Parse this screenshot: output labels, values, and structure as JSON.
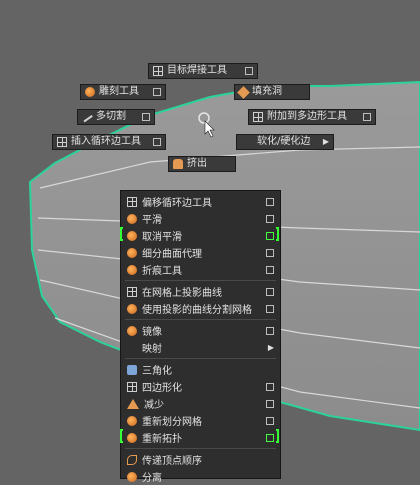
{
  "colors": {
    "mesh_outline": "#2bd39a",
    "highlight": "#42ff42",
    "menu_bg": "#2e2e2e"
  },
  "marking_menu": {
    "top": {
      "label": "目标焊接工具",
      "icon": "grid-icon"
    },
    "left_top": {
      "label": "雕刻工具",
      "icon": "sculpt-icon"
    },
    "right_top": {
      "label": "填充洞",
      "icon": "fill-hole-icon"
    },
    "left": {
      "label": "多切割",
      "icon": "knife-icon"
    },
    "right": {
      "label": "附加到多边形工具",
      "icon": "append-polygon-icon"
    },
    "left_bottom": {
      "label": "插入循环边工具",
      "icon": "insert-loop-icon"
    },
    "right_bottom": {
      "label": "软化/硬化边",
      "icon": "submenu-arrow"
    },
    "bottom": {
      "label": "挤出",
      "icon": "extrude-icon"
    }
  },
  "context_menu": {
    "items": [
      {
        "label": "偏移循环边工具",
        "icon": "offset-loop-icon"
      },
      {
        "label": "平滑",
        "icon": "smooth-icon"
      },
      {
        "label": "取消平滑",
        "icon": "unsmooth-icon"
      },
      {
        "label": "细分曲面代理",
        "icon": "subdiv-proxy-icon"
      },
      {
        "label": "折痕工具",
        "icon": "crease-icon"
      },
      {
        "label": "在网格上投影曲线",
        "icon": "project-curve-icon"
      },
      {
        "label": "使用投影的曲线分割网格",
        "icon": "split-mesh-icon"
      },
      {
        "label": "镜像",
        "icon": "mirror-icon"
      },
      {
        "label": "映射",
        "icon": "submenu-arrow"
      },
      {
        "label": "三角化",
        "icon": "triangulate-icon"
      },
      {
        "label": "四边形化",
        "icon": "quadrangulate-icon"
      },
      {
        "label": "减少",
        "icon": "reduce-icon"
      },
      {
        "label": "重新划分网格",
        "icon": "remesh-icon"
      },
      {
        "label": "重新拓扑",
        "icon": "retopo-icon"
      },
      {
        "label": "传递顶点顺序",
        "icon": "transfer-vertex-icon"
      },
      {
        "label": "分离",
        "icon": "separate-icon"
      }
    ]
  }
}
